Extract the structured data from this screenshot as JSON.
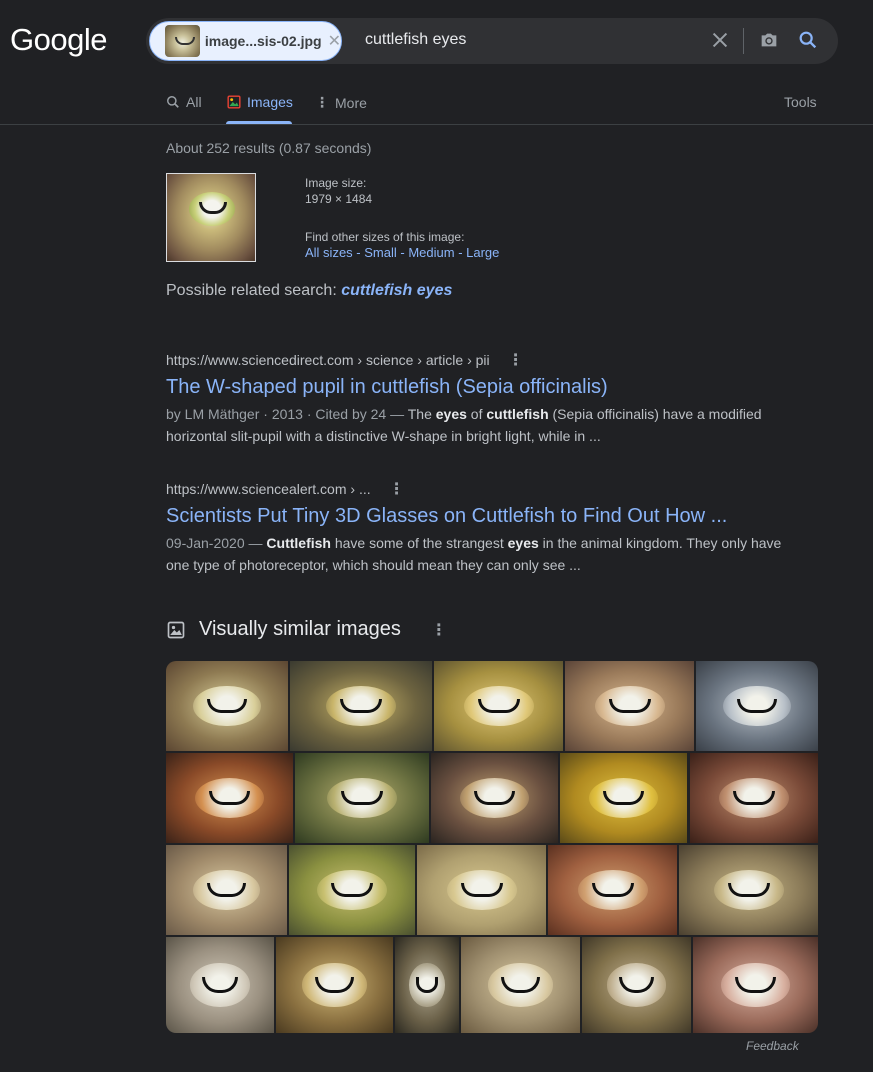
{
  "header": {
    "logo": "Google",
    "image_chip_label": "image...sis-02.jpg",
    "query": "cuttlefish eyes",
    "icons": [
      "close-icon",
      "camera-icon",
      "search-icon"
    ]
  },
  "tabs": [
    {
      "label": "All",
      "icon": "search-icon",
      "active": false
    },
    {
      "label": "Images",
      "icon": "image-icon",
      "active": true
    },
    {
      "label": "More",
      "icon": "more-vert-icon",
      "active": false
    }
  ],
  "tools_label": "Tools",
  "stats": "About 252 results (0.87 seconds)",
  "image_info": {
    "size_label": "Image size:",
    "size_value": "1979 × 1484",
    "other_sizes_label": "Find other sizes of this image:",
    "all_sizes": "All sizes",
    "sep": " - ",
    "small": "Small",
    "medium": "Medium",
    "large": "Large"
  },
  "related": {
    "label": "Possible related search: ",
    "query": "cuttlefish eyes"
  },
  "results": [
    {
      "url": "https://www.sciencedirect.com › science › article › pii",
      "title": "The W-shaped pupil in cuttlefish (Sepia officinalis)",
      "meta": "by LM Mäthger · 2013 · Cited by 24 — ",
      "snippet_parts": [
        "The ",
        "eyes",
        " of ",
        "cuttlefish",
        " (Sepia officinalis) have a modified horizontal slit-pupil with a distinctive W-shape in bright light, while in ..."
      ]
    },
    {
      "url": "https://www.sciencealert.com › ...",
      "title": "Scientists Put Tiny 3D Glasses on Cuttlefish to Find Out How ...",
      "meta": "09-Jan-2020 — ",
      "snippet_parts": [
        "",
        "Cuttlefish",
        " have some of the strangest ",
        "eyes",
        " in the animal kingdom. They only have one type of photoreceptor, which should mean they can only see ..."
      ]
    }
  ],
  "visually_similar": {
    "title": "Visually similar images",
    "icon": "image-icon",
    "image_count": 22
  },
  "feedback": "Feedback",
  "colors": {
    "background": "#202124",
    "link": "#8ab4f8",
    "text": "#bdc1c6"
  }
}
